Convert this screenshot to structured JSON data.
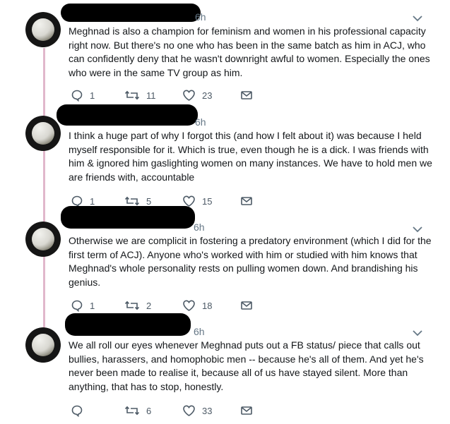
{
  "tweets": [
    {
      "time": "6h",
      "text": "Meghnad is also a champion for feminism and women in his professional capacity right now. But there's no one who has been in the same batch as him in ACJ, who can confidently deny that he wasn't downright awful to women. Especially the ones who were in the same TV group as him.",
      "replies": "1",
      "retweets": "11",
      "likes": "23"
    },
    {
      "time": "6h",
      "text": "I think a huge part of why I forgot this (and how I felt about it) was because I held myself responsible for it. Which is true, even though he is a dick. I was friends with him & ignored him gaslighting women on many instances. We have to hold men we are friends with, accountable",
      "replies": "1",
      "retweets": "5",
      "likes": "15"
    },
    {
      "time": "6h",
      "text": "Otherwise we are complicit in fostering a predatory environment (which I did for the first term of ACJ). Anyone who's worked with him or studied with him knows that Meghnad's whole personality rests on pulling women down. And brandishing his genius.",
      "replies": "1",
      "retweets": "2",
      "likes": "18"
    },
    {
      "time": "6h",
      "text": "We all roll our eyes whenever Meghnad puts out a FB status/ piece that calls out bullies, harassers, and homophobic men -- because he's all of them. And yet he's never been made to realise it, because all of us have stayed silent. More than anything, that has to stop, honestly.",
      "replies": "",
      "retweets": "6",
      "likes": "33"
    }
  ],
  "colors": {
    "thread": "#e1b8cc",
    "icon": "#657786",
    "text": "#14171a"
  }
}
